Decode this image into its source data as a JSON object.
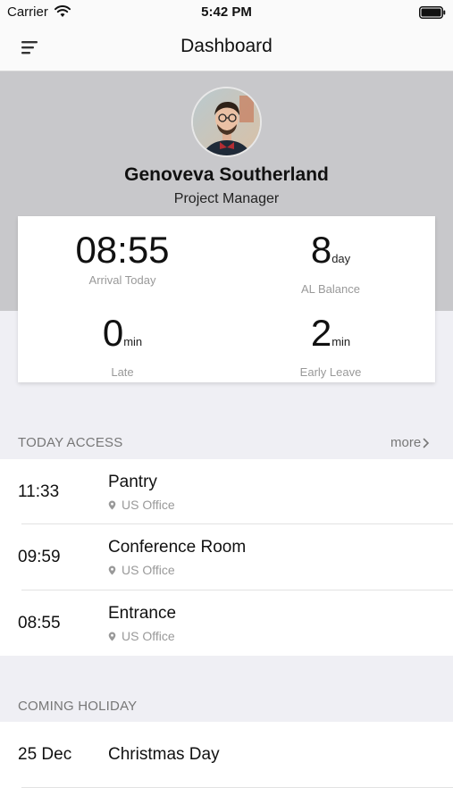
{
  "status": {
    "carrier": "Carrier",
    "time": "5:42 PM"
  },
  "nav": {
    "title": "Dashboard"
  },
  "profile": {
    "name": "Genoveva Southerland",
    "role": "Project Manager"
  },
  "stats": {
    "arrival": {
      "value": "08:55",
      "label": "Arrival Today"
    },
    "al_balance": {
      "value": "8",
      "unit": "day",
      "label": "AL Balance"
    },
    "late": {
      "value": "0",
      "unit": "min",
      "label": "Late"
    },
    "early_leave": {
      "value": "2",
      "unit": "min",
      "label": "Early Leave"
    }
  },
  "today_access": {
    "header": "TODAY ACCESS",
    "more_label": "more",
    "items": [
      {
        "time": "11:33",
        "title": "Pantry",
        "location": "US Office"
      },
      {
        "time": "09:59",
        "title": "Conference Room",
        "location": "US Office"
      },
      {
        "time": "08:55",
        "title": "Entrance",
        "location": "US Office"
      }
    ]
  },
  "coming_holiday": {
    "header": "COMING HOLIDAY",
    "items": [
      {
        "date": "25 Dec",
        "title": "Christmas Day"
      }
    ]
  },
  "icons": {
    "menu": "menu-icon",
    "wifi": "wifi-icon",
    "battery": "battery-icon",
    "location": "location-pin-icon",
    "more": "chevron-right-icon"
  }
}
